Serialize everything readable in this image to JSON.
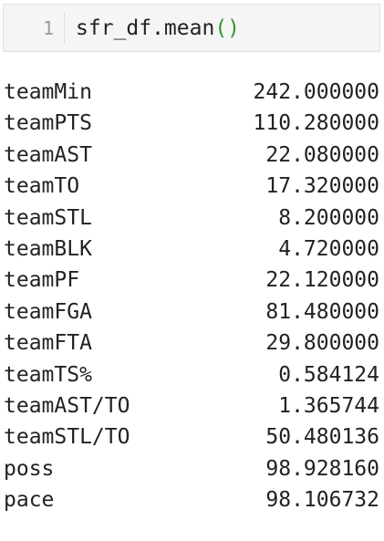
{
  "cell": {
    "line_number": "1",
    "code_prefix": "sfr_df.mean",
    "code_parens": "()"
  },
  "output": {
    "rows": [
      {
        "label": "teamMin",
        "value": "242.000000"
      },
      {
        "label": "teamPTS",
        "value": "110.280000"
      },
      {
        "label": "teamAST",
        "value": "22.080000"
      },
      {
        "label": "teamTO",
        "value": "17.320000"
      },
      {
        "label": "teamSTL",
        "value": "8.200000"
      },
      {
        "label": "teamBLK",
        "value": "4.720000"
      },
      {
        "label": "teamPF",
        "value": "22.120000"
      },
      {
        "label": "teamFGA",
        "value": "81.480000"
      },
      {
        "label": "teamFTA",
        "value": "29.800000"
      },
      {
        "label": "teamTS%",
        "value": "0.584124"
      },
      {
        "label": "teamAST/TO",
        "value": "1.365744"
      },
      {
        "label": "teamSTL/TO",
        "value": "50.480136"
      },
      {
        "label": "poss",
        "value": "98.928160"
      },
      {
        "label": "pace",
        "value": "98.106732"
      }
    ]
  },
  "colors": {
    "code_text": "#222222",
    "paren_green": "#2e9a2e",
    "cell_background": "#f5f5f5",
    "line_number_gray": "#9a9a9a"
  }
}
